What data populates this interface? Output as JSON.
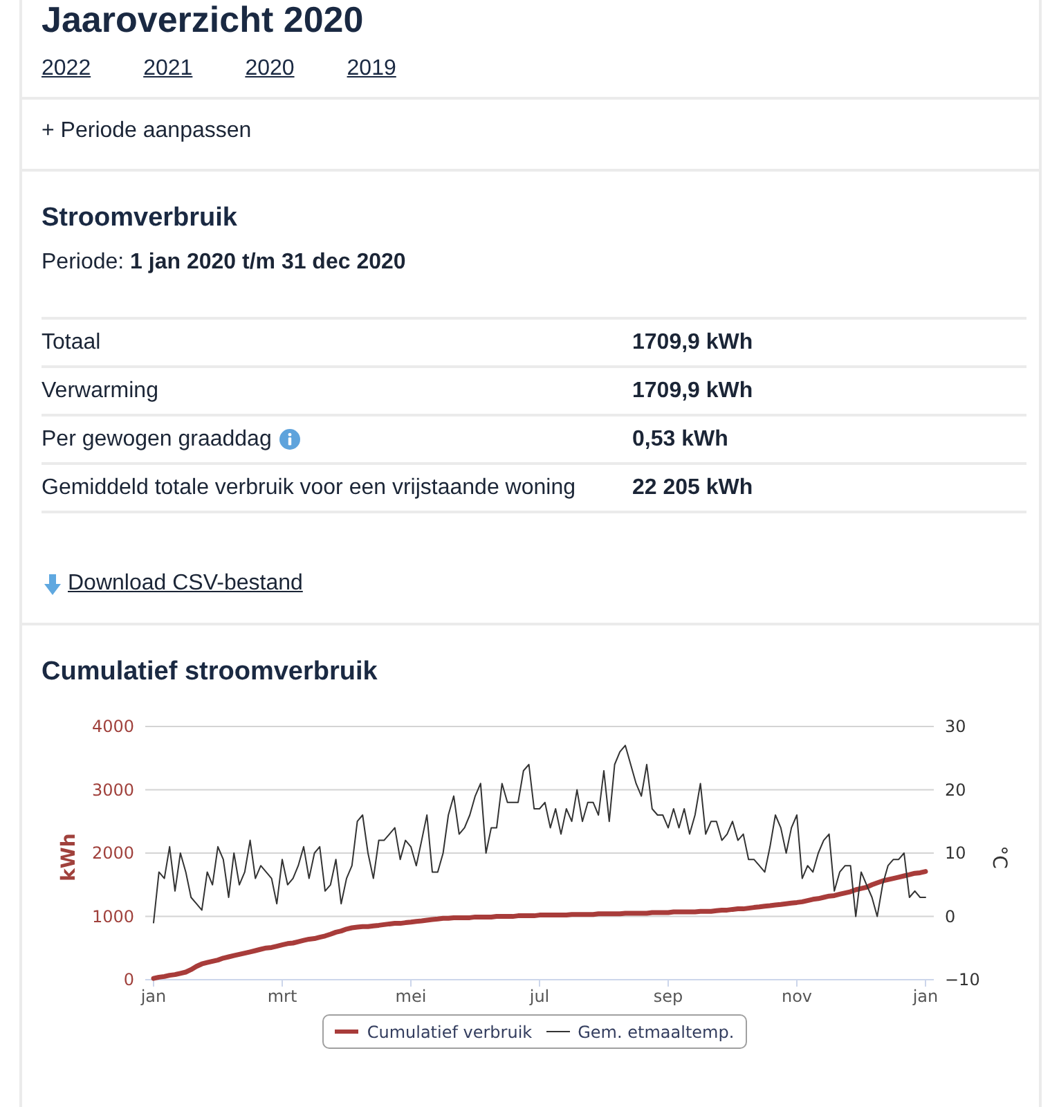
{
  "page": {
    "title": "Jaaroverzicht 2020"
  },
  "year_links": [
    "2022",
    "2021",
    "2020",
    "2019"
  ],
  "period_toggle": {
    "label": "+ Periode aanpassen"
  },
  "usage": {
    "heading": "Stroomverbruik",
    "period": "Periode: **1 jan 2020 t/m 31 dec 2020**",
    "rows": [
      {
        "label": "Totaal",
        "value": "1709,9 kWh",
        "info": false
      },
      {
        "label": "Verwarming",
        "value": "1709,9 kWh",
        "info": false
      },
      {
        "label": "Per gewogen graaddag",
        "value": "0,53 kWh",
        "info": true
      },
      {
        "label": "Gemiddeld totale verbruik voor een vrijstaande woning",
        "value": "22 205 kWh",
        "info": false
      }
    ]
  },
  "download": {
    "label": "Download CSV-bestand"
  },
  "chart": {
    "heading": "Cumulatief stroomverbruik",
    "chart_data": {
      "type": "line",
      "grid": "y",
      "legend": "bottom",
      "ylabel": "kWh",
      "ylim": [
        0,
        4000
      ],
      "yticks": [
        0,
        1000,
        2000,
        3000,
        4000
      ],
      "y2label": "°C",
      "y2lim": [
        -10,
        30
      ],
      "y2ticks": [
        {
          "value": -10,
          "label": "−10"
        },
        0,
        10,
        20,
        30
      ],
      "categories": [
        "jan",
        null,
        null,
        null,
        null,
        null,
        null,
        null,
        null,
        null,
        null,
        null,
        null,
        null,
        null,
        null,
        null,
        null,
        null,
        null,
        null,
        null,
        null,
        null,
        "mrt",
        null,
        null,
        null,
        null,
        null,
        null,
        null,
        null,
        null,
        null,
        null,
        null,
        null,
        null,
        null,
        null,
        null,
        null,
        null,
        null,
        null,
        null,
        null,
        "mei",
        null,
        null,
        null,
        null,
        null,
        null,
        null,
        null,
        null,
        null,
        null,
        null,
        null,
        null,
        null,
        null,
        null,
        null,
        null,
        null,
        null,
        null,
        null,
        "jul",
        null,
        null,
        null,
        null,
        null,
        null,
        null,
        null,
        null,
        null,
        null,
        null,
        null,
        null,
        null,
        null,
        null,
        null,
        null,
        null,
        null,
        null,
        null,
        "sep",
        null,
        null,
        null,
        null,
        null,
        null,
        null,
        null,
        null,
        null,
        null,
        null,
        null,
        null,
        null,
        null,
        null,
        null,
        null,
        null,
        null,
        null,
        null,
        "nov",
        null,
        null,
        null,
        null,
        null,
        null,
        null,
        null,
        null,
        null,
        null,
        null,
        null,
        null,
        null,
        null,
        null,
        null,
        null,
        null,
        null,
        null,
        null,
        "jan"
      ],
      "series": [
        {
          "name": "Cumulatief verbruik",
          "color": "#a83c3a",
          "values": [
            20,
            40,
            50,
            70,
            80,
            100,
            120,
            160,
            210,
            250,
            270,
            290,
            310,
            340,
            360,
            380,
            400,
            420,
            440,
            460,
            480,
            500,
            510,
            530,
            550,
            570,
            580,
            600,
            620,
            640,
            650,
            670,
            690,
            720,
            750,
            770,
            800,
            820,
            830,
            840,
            840,
            850,
            860,
            870,
            880,
            890,
            890,
            900,
            910,
            920,
            930,
            940,
            950,
            960,
            970,
            970,
            980,
            980,
            980,
            980,
            990,
            990,
            990,
            990,
            1000,
            1000,
            1000,
            1000,
            1010,
            1010,
            1010,
            1010,
            1020,
            1020,
            1020,
            1020,
            1020,
            1020,
            1030,
            1030,
            1030,
            1030,
            1030,
            1040,
            1040,
            1040,
            1040,
            1040,
            1050,
            1050,
            1050,
            1050,
            1050,
            1060,
            1060,
            1060,
            1060,
            1070,
            1070,
            1070,
            1070,
            1070,
            1080,
            1080,
            1080,
            1090,
            1100,
            1100,
            1110,
            1120,
            1120,
            1130,
            1140,
            1150,
            1160,
            1170,
            1180,
            1190,
            1200,
            1210,
            1220,
            1230,
            1250,
            1270,
            1280,
            1300,
            1320,
            1330,
            1350,
            1370,
            1390,
            1420,
            1440,
            1460,
            1500,
            1530,
            1560,
            1580,
            1600,
            1620,
            1640,
            1660,
            1680,
            1690,
            1710
          ]
        },
        {
          "name": "Gem. etmaaltemp.",
          "color": "#333333",
          "axis": "y2",
          "values": [
            -1,
            7,
            6,
            11,
            4,
            10,
            7,
            3,
            2,
            1,
            7,
            5,
            11,
            9,
            3,
            10,
            5,
            7,
            12,
            6,
            8,
            7,
            6,
            2,
            9,
            5,
            6,
            8,
            11,
            6,
            10,
            11,
            4,
            5,
            9,
            2,
            6,
            8,
            15,
            16,
            10,
            6,
            12,
            12,
            13,
            14,
            9,
            12,
            11,
            8,
            12,
            16,
            7,
            7,
            10,
            16,
            19,
            13,
            14,
            16,
            19,
            21,
            10,
            14,
            14,
            21,
            18,
            18,
            18,
            23,
            24,
            17,
            17,
            18,
            14,
            17,
            13,
            17,
            15,
            20,
            15,
            18,
            18,
            16,
            23,
            15,
            24,
            26,
            27,
            24,
            21,
            19,
            24,
            17,
            16,
            16,
            14,
            17,
            14,
            17,
            13,
            16,
            21,
            13,
            15,
            15,
            12,
            13,
            15,
            12,
            13,
            9,
            9,
            8,
            7,
            11,
            16,
            14,
            10,
            14,
            16,
            6,
            8,
            7,
            10,
            12,
            13,
            4,
            7,
            8,
            8,
            0,
            7,
            5,
            3,
            0,
            5,
            8,
            9,
            9,
            10,
            3,
            4,
            3,
            3
          ]
        }
      ]
    }
  }
}
